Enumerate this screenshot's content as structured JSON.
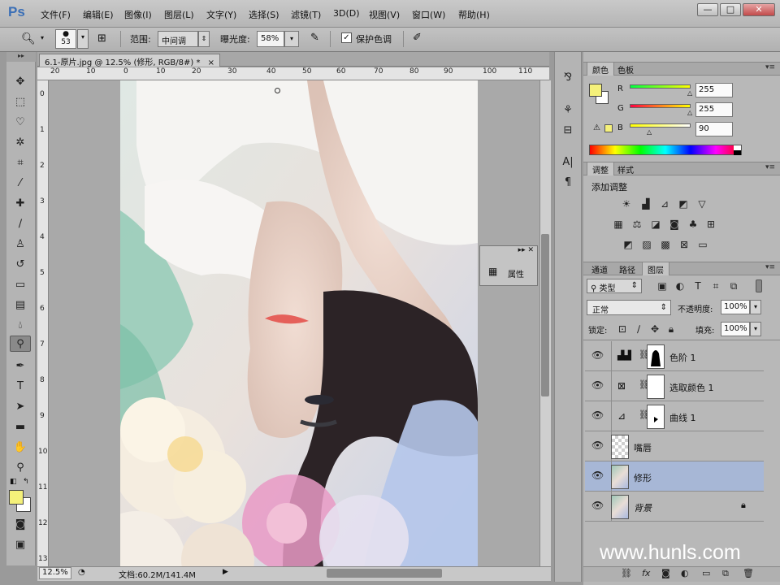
{
  "app": {
    "logo": "Ps"
  },
  "menu": [
    "文件(F)",
    "编辑(E)",
    "图像(I)",
    "图层(L)",
    "文字(Y)",
    "选择(S)",
    "滤镜(T)",
    "3D(D)",
    "视图(V)",
    "窗口(W)",
    "帮助(H)"
  ],
  "window_controls": {
    "minimize": "—",
    "restore": "□",
    "close": "✕"
  },
  "options": {
    "brush_size": "53",
    "range_label": "范围:",
    "range_value": "中间调",
    "exposure_label": "曝光度:",
    "exposure_value": "58%",
    "protect_tones_label": "保护色调",
    "protect_tones_checked": true
  },
  "document": {
    "tab_title": "6.1-原片.jpg @ 12.5% (修形, RGB/8#) *",
    "tab_close": "×",
    "ruler_top": [
      "20",
      "10",
      "0",
      "10",
      "20",
      "30",
      "40",
      "50",
      "60",
      "70",
      "80",
      "90",
      "100",
      "110"
    ],
    "ruler_left": [
      "0",
      "1",
      "2",
      "3",
      "4",
      "5",
      "6",
      "7",
      "8",
      "9",
      "10",
      "11",
      "12",
      "13"
    ],
    "zoom": "12.5%",
    "doc_size": "文档:60.2M/141.4M"
  },
  "properties_panel": {
    "label": "属性"
  },
  "color_panel": {
    "tabs": [
      "颜色",
      "色板"
    ],
    "foreground": "#f5f17a",
    "background": "#ffffff",
    "r_label": "R",
    "g_label": "G",
    "b_label": "B",
    "r": "255",
    "g": "255",
    "b": "90"
  },
  "adjustments_panel": {
    "tabs": [
      "调整",
      "样式"
    ],
    "title": "添加调整"
  },
  "layers_panel": {
    "tabs": [
      "通道",
      "路径",
      "图层"
    ],
    "filter_kind": "类型",
    "blend_mode": "正常",
    "opacity_label": "不透明度:",
    "opacity": "100%",
    "lock_label": "锁定:",
    "fill_label": "填充:",
    "fill": "100%",
    "layers": [
      {
        "name": "色阶 1",
        "type": "adjustment",
        "active": false
      },
      {
        "name": "选取颜色 1",
        "type": "adjustment",
        "active": false
      },
      {
        "name": "曲线 1",
        "type": "adjustment",
        "active": false
      },
      {
        "name": "嘴唇",
        "type": "pixel-empty",
        "active": false
      },
      {
        "name": "修形",
        "type": "pixel",
        "active": true
      },
      {
        "name": "背景",
        "type": "background",
        "active": false,
        "locked": true
      }
    ]
  },
  "watermark": "www.hunls.com"
}
